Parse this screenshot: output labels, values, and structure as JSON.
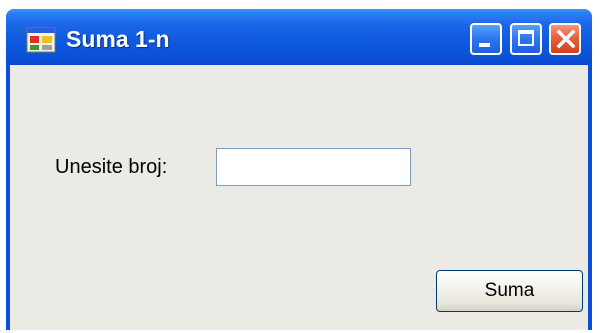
{
  "window": {
    "title": "Suma 1-n",
    "icon": "application-icon",
    "controls": {
      "minimize_icon": "minimize-icon",
      "maximize_icon": "maximize-icon",
      "close_icon": "close-icon"
    }
  },
  "form": {
    "number_label": "Unesite broj:",
    "number_value": "",
    "number_placeholder": "",
    "sum_button_label": "Suma"
  },
  "colors": {
    "titlebar": "#0c53d8",
    "close_button": "#e5603d",
    "client_background": "#ebeae4"
  }
}
